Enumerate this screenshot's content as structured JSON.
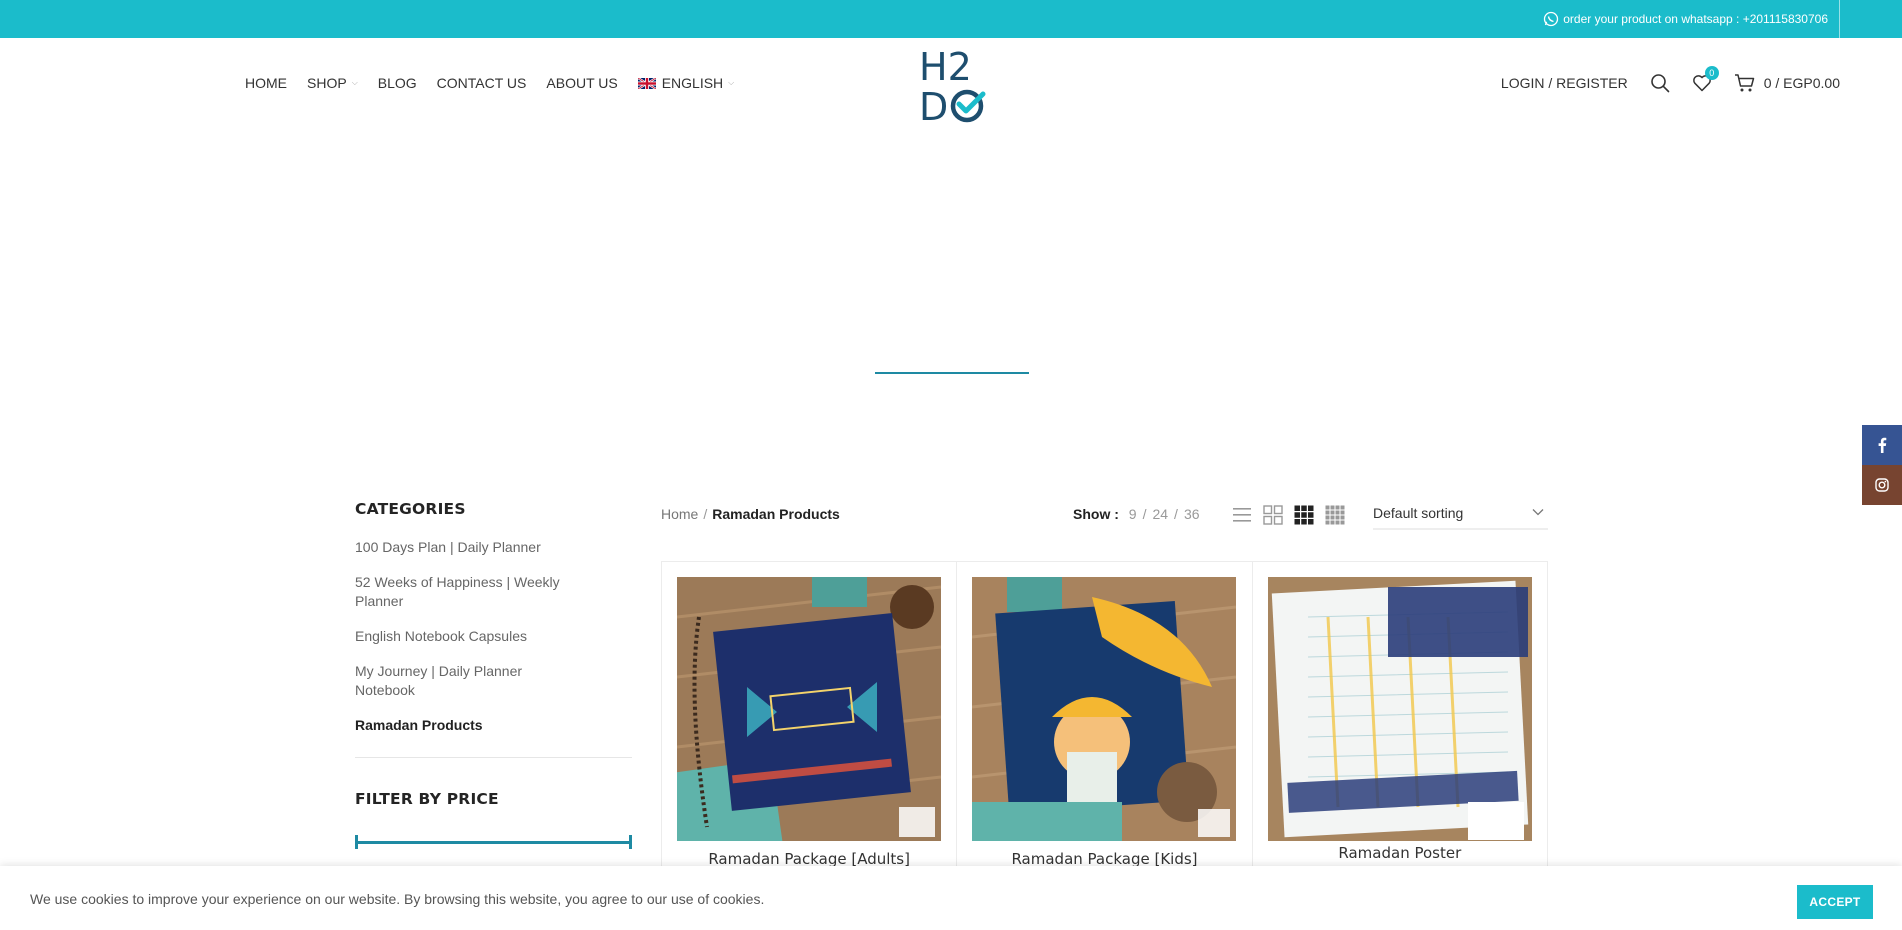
{
  "topbar": {
    "whatsapp_text": "order your product on whatsapp : +201115830706"
  },
  "nav": {
    "items": [
      {
        "label": "HOME"
      },
      {
        "label": "SHOP",
        "has_dropdown": true
      },
      {
        "label": "BLOG"
      },
      {
        "label": "CONTACT US"
      },
      {
        "label": "ABOUT US"
      },
      {
        "label": "ENGLISH",
        "has_dropdown": true,
        "icon": "uk-flag-icon"
      }
    ]
  },
  "logo": {
    "text_top": "H2",
    "text_bottom": "D",
    "icon": "checkmark-icon"
  },
  "header_right": {
    "login_label": "LOGIN / REGISTER",
    "wishlist_count": "0",
    "cart_label": "0 / EGP0.00"
  },
  "sidebar": {
    "categories_title": "CATEGORIES",
    "categories": [
      {
        "label": "100 Days Plan | Daily Planner"
      },
      {
        "label": "52 Weeks of Happiness | Weekly Planner"
      },
      {
        "label": "English Notebook Capsules"
      },
      {
        "label": "My Journey | Daily Planner Notebook"
      },
      {
        "label": "Ramadan Products",
        "active": true
      }
    ],
    "filter_title": "FILTER BY PRICE"
  },
  "toolbar": {
    "breadcrumb_home": "Home",
    "breadcrumb_sep": "/",
    "breadcrumb_current": "Ramadan Products",
    "show_label": "Show :",
    "show_options": [
      "9",
      "24",
      "36"
    ],
    "show_sep": "/",
    "sorting": "Default sorting"
  },
  "products": [
    {
      "name": "Ramadan Package [Adults]"
    },
    {
      "name": "Ramadan Package [Kids]"
    },
    {
      "name": "Ramadan Poster"
    }
  ],
  "cookie": {
    "message": "We use cookies to improve your experience on our website. By browsing this website, you agree to our use of cookies.",
    "accept_label": "ACCEPT"
  },
  "colors": {
    "accent": "#1bbccb",
    "brand_dark": "#1e4e6e",
    "facebook": "#365493",
    "instagram": "#774430"
  }
}
